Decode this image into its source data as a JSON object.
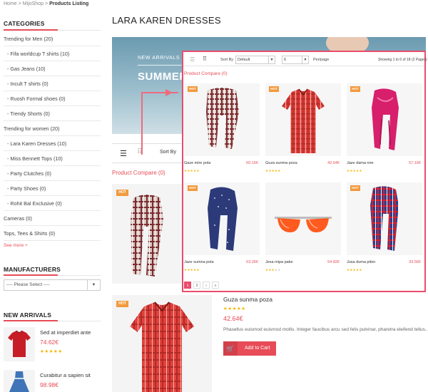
{
  "breadcrumb": {
    "home": "Home",
    "shop": "MijoShop",
    "current": "Products Listing",
    "separator": ">"
  },
  "categories": {
    "heading": "CATEGORIES",
    "items": [
      {
        "label": "Trending for Men (20)",
        "sub": false
      },
      {
        "label": "- Fifa worldcup T shirts (10)",
        "sub": true
      },
      {
        "label": "- Gas Jeans (10)",
        "sub": true
      },
      {
        "label": "- Incult T shirts (0)",
        "sub": true
      },
      {
        "label": "- Ruosh Formal shoes (0)",
        "sub": true
      },
      {
        "label": "- Trendy Shorts (0)",
        "sub": true
      },
      {
        "label": "Trending for women (20)",
        "sub": false
      },
      {
        "label": "- Lara Karen Dresses (10)",
        "sub": true
      },
      {
        "label": "- Miss Bennett Tops (10)",
        "sub": true
      },
      {
        "label": "- Party Clutches (0)",
        "sub": true
      },
      {
        "label": "- Party Shoes (0)",
        "sub": true
      },
      {
        "label": "- Rohit Bal Exclusive (0)",
        "sub": true
      },
      {
        "label": "Cameras (0)",
        "sub": false
      },
      {
        "label": "Tops, Tees & Shirts (0)",
        "sub": false
      }
    ],
    "see_more": "See more +"
  },
  "manufacturers": {
    "heading": "MANUFACTURERS",
    "select_value": "---- Please Select ----",
    "dropdown_icon": "chevron-down-icon"
  },
  "new_arrivals": {
    "heading": "NEW ARRIVALS",
    "items": [
      {
        "title": "Sed at imperdiet ante",
        "price": "74.62€",
        "stars": "★★★★★"
      },
      {
        "title": "Curabitur a sapien sit",
        "price": "98.98€",
        "stars": ""
      }
    ]
  },
  "main": {
    "title": "LARA KAREN DRESSES",
    "banner": {
      "sub": "NEW ARRIVALS",
      "main": "SUMMER C"
    },
    "toolbar": {
      "list_icon": "☰",
      "grid_icon": "⠿",
      "sort_label": "Sort By"
    },
    "product_compare": "Product Compare (0)",
    "hot_badge": "HOT",
    "detail": {
      "name": "Guza sunma poza",
      "stars": "★★★★★",
      "price": "42.64€",
      "description": "Phasellus euismod euismod mollis. Integer faucibus arcu sed felis pulvinar, pharetra eleifend tellus..",
      "add_to_cart": "Add to Cart",
      "cart_icon": "🛒"
    }
  },
  "overlay": {
    "list_icon": "☰",
    "grid_icon": "⠿",
    "sort_label": "Sort By",
    "sort_value": "Default",
    "perpage_value": "6",
    "perpage_label": "Per/page",
    "showing": "Showing 1 to 6 of 18 (2 Pages)",
    "product_compare": "Product Compare (0)",
    "products": [
      {
        "name": "Gaze mire pola",
        "price": "60.15€",
        "badge": "HOT",
        "rating": 5,
        "image": "plaid-scarf"
      },
      {
        "name": "Guza sunma poza",
        "price": "42.64€",
        "badge": "HOT",
        "rating": 5,
        "image": "red-shirt"
      },
      {
        "name": "Jaze dama nire",
        "price": "57.16€",
        "badge": "HOT",
        "rating": 5,
        "image": "pink-scarf"
      },
      {
        "name": "Jaze sumna pola",
        "price": "63.26€",
        "badge": "HOT",
        "rating": 5,
        "image": "navy-scarf"
      },
      {
        "name": "Jesa mipa pake",
        "price": "54.82€",
        "badge": "",
        "rating": 3,
        "image": "sunglasses"
      },
      {
        "name": "Jusa duma piton",
        "price": "33.56€",
        "badge": "HOT",
        "rating": 5,
        "image": "tartan-scarf"
      }
    ],
    "pagination": [
      "1",
      "2",
      "›",
      "»"
    ]
  },
  "colors": {
    "accent": "#e74c57",
    "overlay_border": "#ea4c6c",
    "hot": "#f29a3c",
    "star": "#f5b400"
  }
}
